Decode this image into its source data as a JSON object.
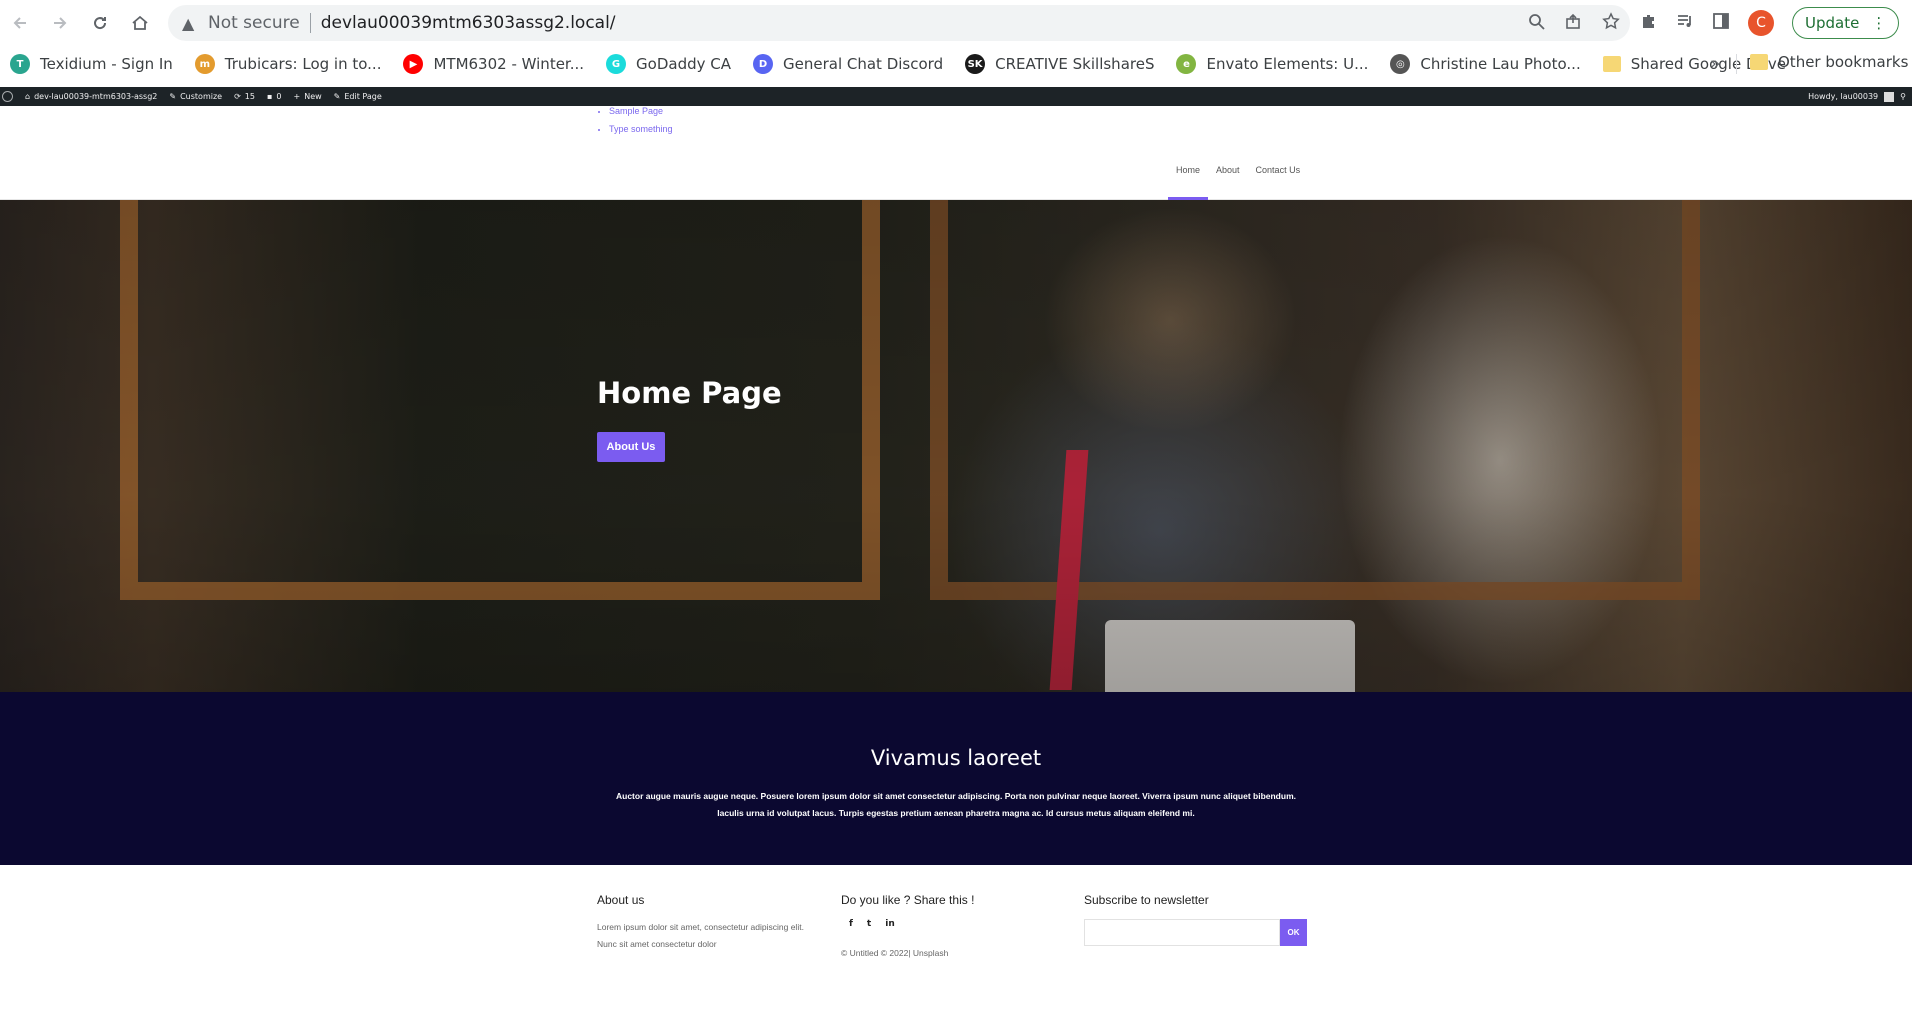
{
  "browser": {
    "security_label": "Not secure",
    "url": "devlau00039mtm6303assg2.local/",
    "profile_initial": "C",
    "update_label": "Update"
  },
  "bookmarks": {
    "items": [
      {
        "label": "Texidium - Sign In",
        "icon": "texidium-icon",
        "color": "#2aa58f",
        "glyph": "T"
      },
      {
        "label": "Trubicars: Log in to...",
        "icon": "trubicars-icon",
        "color": "#e39b2e",
        "glyph": "m"
      },
      {
        "label": "MTM6302 - Winter...",
        "icon": "youtube-icon",
        "color": "#ff0000",
        "glyph": "▶"
      },
      {
        "label": "GoDaddy CA",
        "icon": "godaddy-icon",
        "color": "#1bdbdb",
        "glyph": "G"
      },
      {
        "label": "General Chat Discord",
        "icon": "discord-icon",
        "color": "#5865f2",
        "glyph": "D"
      },
      {
        "label": "CREATIVE SkillshareS",
        "icon": "skillshare-icon",
        "color": "#1a1a1a",
        "glyph": "SK"
      },
      {
        "label": "Envato Elements: U...",
        "icon": "envato-icon",
        "color": "#82b541",
        "glyph": "e"
      },
      {
        "label": "Christine Lau Photo...",
        "icon": "globe-icon",
        "color": "#555555",
        "glyph": "◎"
      },
      {
        "label": "Shared Google Drive",
        "icon": "folder-icon",
        "color": "#f6d775",
        "glyph": ""
      }
    ],
    "more": "»",
    "other": "Other bookmarks"
  },
  "wpbar": {
    "site": "dev-lau00039-mtm6303-assg2",
    "customize": "Customize",
    "updates": "15",
    "comments": "0",
    "new": "New",
    "edit": "Edit Page",
    "howdy": "Howdy, lau00039"
  },
  "site": {
    "page_list": [
      "Sample Page",
      "Type something"
    ],
    "nav": [
      "Home",
      "About",
      "Contact Us"
    ],
    "active_nav": "Home"
  },
  "hero": {
    "title": "Home Page",
    "button": "About Us"
  },
  "band": {
    "title": "Vivamus laoreet",
    "text": "Auctor augue mauris augue neque. Posuere lorem ipsum dolor sit amet consectetur adipiscing. Porta non pulvinar neque laoreet. Viverra ipsum nunc aliquet bibendum. Iaculis urna id volutpat lacus. Turpis egestas pretium aenean pharetra magna ac. Id cursus metus aliquam eleifend mi."
  },
  "footer": {
    "about_title": "About us",
    "about_text": "Lorem ipsum dolor sit amet, consectetur adipiscing elit. Nunc sit amet consectetur dolor",
    "share_title": "Do you like ? Share this !",
    "socials": [
      "f",
      "t",
      "in"
    ],
    "copyright": "© Untitled © 2022| Unsplash",
    "newsletter_title": "Subscribe to newsletter",
    "newsletter_button": "OK"
  },
  "colors": {
    "accent": "#7b5cf0",
    "band_bg": "#0b0830",
    "wpbar_bg": "#1d2327"
  }
}
